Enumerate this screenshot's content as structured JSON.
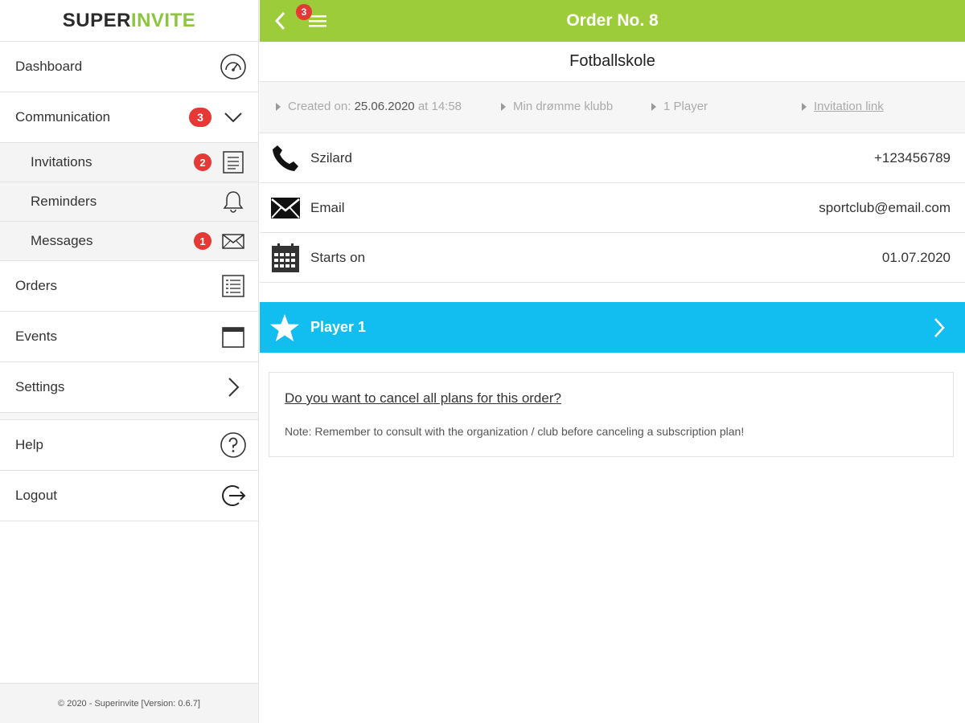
{
  "sidebar": {
    "logo": {
      "part1": "SUPER",
      "part2": "INVITE"
    },
    "items": {
      "dashboard": {
        "label": "Dashboard",
        "icon": "dashboard-gauge-icon"
      },
      "communication": {
        "label": "Communication",
        "badge": "3",
        "icon": "chevron-down-icon"
      },
      "invitations": {
        "label": "Invitations",
        "badge": "2",
        "icon": "document-icon"
      },
      "reminders": {
        "label": "Reminders",
        "icon": "bell-icon"
      },
      "messages": {
        "label": "Messages",
        "badge": "1",
        "icon": "envelope-icon"
      },
      "orders": {
        "label": "Orders",
        "icon": "list-icon"
      },
      "events": {
        "label": "Events",
        "icon": "calendar-icon"
      },
      "settings": {
        "label": "Settings",
        "icon": "chevron-right-icon"
      },
      "help": {
        "label": "Help",
        "icon": "help-circle-icon"
      },
      "logout": {
        "label": "Logout",
        "icon": "logout-icon"
      }
    },
    "footer": "© 2020 - Superinvite [Version: 0.6.7]"
  },
  "topbar": {
    "title": "Order No. 8",
    "menu_badge": "3",
    "colors": {
      "background": "#9ccc3a"
    }
  },
  "order": {
    "title": "Fotballskole",
    "meta": {
      "created_prefix": "Created on:",
      "created_date": "25.06.2020",
      "created_at": "at 14:58",
      "club": "Min drømme klubb",
      "players": "1 Player",
      "invitation_link": "Invitation link"
    },
    "rows": {
      "contact": {
        "label": "Szilard",
        "value": "+123456789",
        "icon": "phone-icon"
      },
      "email": {
        "label": "Email",
        "value": "sportclub@email.com",
        "icon": "envelope-icon"
      },
      "starts": {
        "label": "Starts on",
        "value": "01.07.2020",
        "icon": "calendar-icon"
      }
    },
    "player": {
      "label": "Player 1",
      "icon": "star-icon",
      "color": "#12bdf0"
    },
    "cancel": {
      "link": "Do you want to cancel all plans for this order?",
      "note": "Note: Remember to consult with the organization / club before canceling a subscription plan!"
    }
  }
}
